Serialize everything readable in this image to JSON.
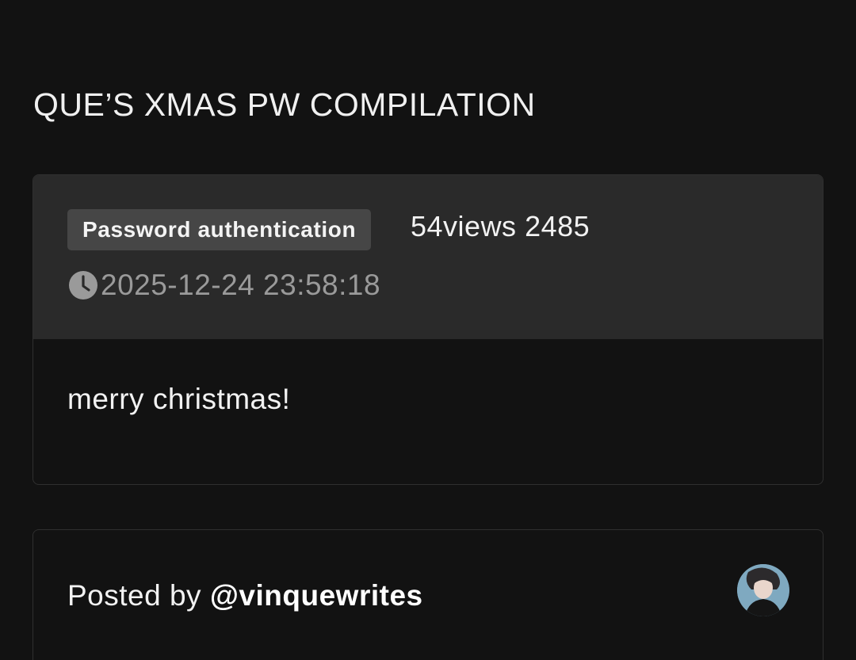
{
  "post": {
    "title": "QUE’S XMAS PW COMPILATION",
    "badge": "Password authentication",
    "views_text": "54views",
    "number": "2485",
    "timestamp": "2025-12-24 23:58:18",
    "body": "merry christmas!"
  },
  "author": {
    "posted_by_label": "Posted by",
    "handle": "@vinquewrites"
  },
  "icons": {
    "clock": "clock-icon",
    "avatar": "avatar"
  },
  "colors": {
    "background": "#121212",
    "header_panel": "#2a2a2a",
    "badge_bg": "#464646",
    "muted_text": "#9a9a9a"
  }
}
